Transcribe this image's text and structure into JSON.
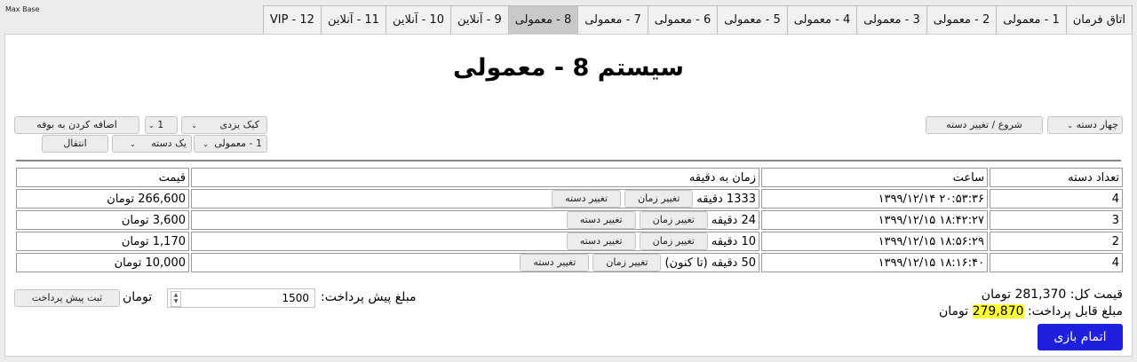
{
  "app": {
    "title": "Max Base"
  },
  "tabs": [
    {
      "label": "اتاق فرمان",
      "active": false
    },
    {
      "label": "1 - معمولی",
      "active": false
    },
    {
      "label": "2 - معمولی",
      "active": false
    },
    {
      "label": "3 - معمولی",
      "active": false
    },
    {
      "label": "4 - معمولی",
      "active": false
    },
    {
      "label": "5 - معمولی",
      "active": false
    },
    {
      "label": "6 - معمولی",
      "active": false
    },
    {
      "label": "7 - معمولی",
      "active": false
    },
    {
      "label": "8 - معمولی",
      "active": true
    },
    {
      "label": "9 - آنلاین",
      "active": false
    },
    {
      "label": "10 - آنلاین",
      "active": false
    },
    {
      "label": "11 - آنلاین",
      "active": false
    },
    {
      "label": "VIP - 12",
      "active": false
    }
  ],
  "page": {
    "title": "سیستم 8 - معمولی"
  },
  "controls": {
    "controller_select": "چهار دسته",
    "start_button": "شروع / تغییر دسته",
    "item_select": "کیک یزدی",
    "qty_select": "1",
    "add_button": "اضافه کردن به بوفه",
    "target_system_select": "1 - معمولی",
    "target_controller_select": "یک دسته",
    "transfer_button": "انتقال"
  },
  "table": {
    "headers": {
      "controllers": "تعداد دسته",
      "time": "ساعت",
      "minutes": "زمان به دقیقه",
      "price": "قیمت"
    },
    "change_time_label": "تغییر زمان",
    "change_controller_label": "تغییر دسته",
    "rows": [
      {
        "controllers": "4",
        "time": "۲۰:۵۳:۳۶ ۱۳۹۹/۱۲/۱۴",
        "minutes": "1333 دقیقه",
        "price": "266,600 تومان"
      },
      {
        "controllers": "3",
        "time": "۱۸:۴۲:۲۷ ۱۳۹۹/۱۲/۱۵",
        "minutes": "24 دقیقه",
        "price": "3,600 تومان"
      },
      {
        "controllers": "2",
        "time": "۱۸:۵۶:۲۹ ۱۳۹۹/۱۲/۱۵",
        "minutes": "10 دقیقه",
        "price": "1,170 تومان"
      },
      {
        "controllers": "4",
        "time": "۱۸:۱۶:۴۰ ۱۳۹۹/۱۲/۱۵",
        "minutes": "50 دقیقه (تا کنون)",
        "price": "10,000 تومان"
      }
    ]
  },
  "footer": {
    "total_label": "قیمت کل:",
    "total_value": "281,370",
    "currency": "تومان",
    "payable_label": "مبلغ قابل پرداخت:",
    "payable_value": "279,870",
    "prepay_label": "مبلغ پیش پرداخت:",
    "prepay_value": "1500",
    "prepay_currency": "تومان",
    "prepay_button": "ثبت پیش پرداخت",
    "finish_button": "اتمام بازی",
    "highlight_color": "#ffff33",
    "finish_color": "#1f1fe0"
  }
}
